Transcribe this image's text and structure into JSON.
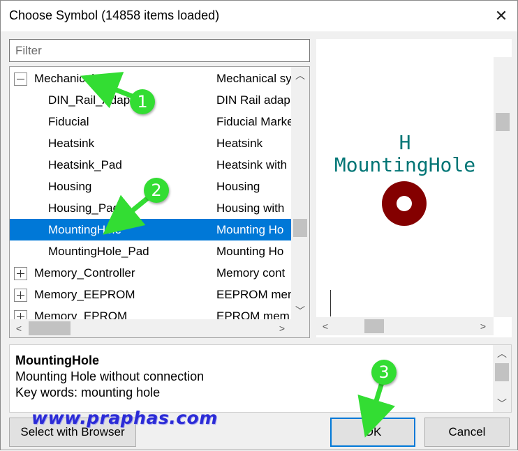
{
  "window": {
    "title": "Choose Symbol (14858 items loaded)",
    "close_glyph": "✕"
  },
  "filter": {
    "placeholder": "Filter",
    "value": ""
  },
  "tree": {
    "rows": [
      {
        "name": "Mechanical",
        "desc": "Mechanical sy",
        "level": 0,
        "expander": "minus",
        "selected": false
      },
      {
        "name": "DIN_Rail_Adap",
        "desc": "DIN Rail adap",
        "level": 1,
        "selected": false
      },
      {
        "name": "Fiducial",
        "desc": "Fiducial Marke",
        "level": 1,
        "selected": false
      },
      {
        "name": "Heatsink",
        "desc": "Heatsink",
        "level": 1,
        "selected": false
      },
      {
        "name": "Heatsink_Pad",
        "desc": "Heatsink with",
        "level": 1,
        "selected": false
      },
      {
        "name": "Housing",
        "desc": "Housing",
        "level": 1,
        "selected": false
      },
      {
        "name": "Housing_Pad",
        "desc": "Housing with",
        "level": 1,
        "selected": false
      },
      {
        "name": "MountingHole",
        "desc": "Mounting Ho",
        "level": 1,
        "selected": true
      },
      {
        "name": "MountingHole_Pad",
        "desc": "Mounting Ho",
        "level": 1,
        "selected": false
      },
      {
        "name": "Memory_Controller",
        "desc": "Memory cont",
        "level": 0,
        "expander": "plus",
        "selected": false
      },
      {
        "name": "Memory_EEPROM",
        "desc": "EEPROM mem",
        "level": 0,
        "expander": "plus",
        "selected": false
      },
      {
        "name": "Memory_EPROM",
        "desc": "EPROM mem",
        "level": 0,
        "expander": "plus",
        "selected": false
      }
    ]
  },
  "preview": {
    "reference": "H",
    "value": "MountingHole",
    "ref_color": "#007575",
    "pad_color": "#840000"
  },
  "details": {
    "name": "MountingHole",
    "description": "Mounting Hole without connection",
    "keywords": "Key words: mounting hole"
  },
  "buttons": {
    "browser": "Select with Browser",
    "ok": "OK",
    "cancel": "Cancel"
  },
  "watermark": "www.praphas.com",
  "callouts": [
    "1",
    "2",
    "3"
  ],
  "colors": {
    "selection": "#0078d7",
    "callout": "#33dd33"
  }
}
